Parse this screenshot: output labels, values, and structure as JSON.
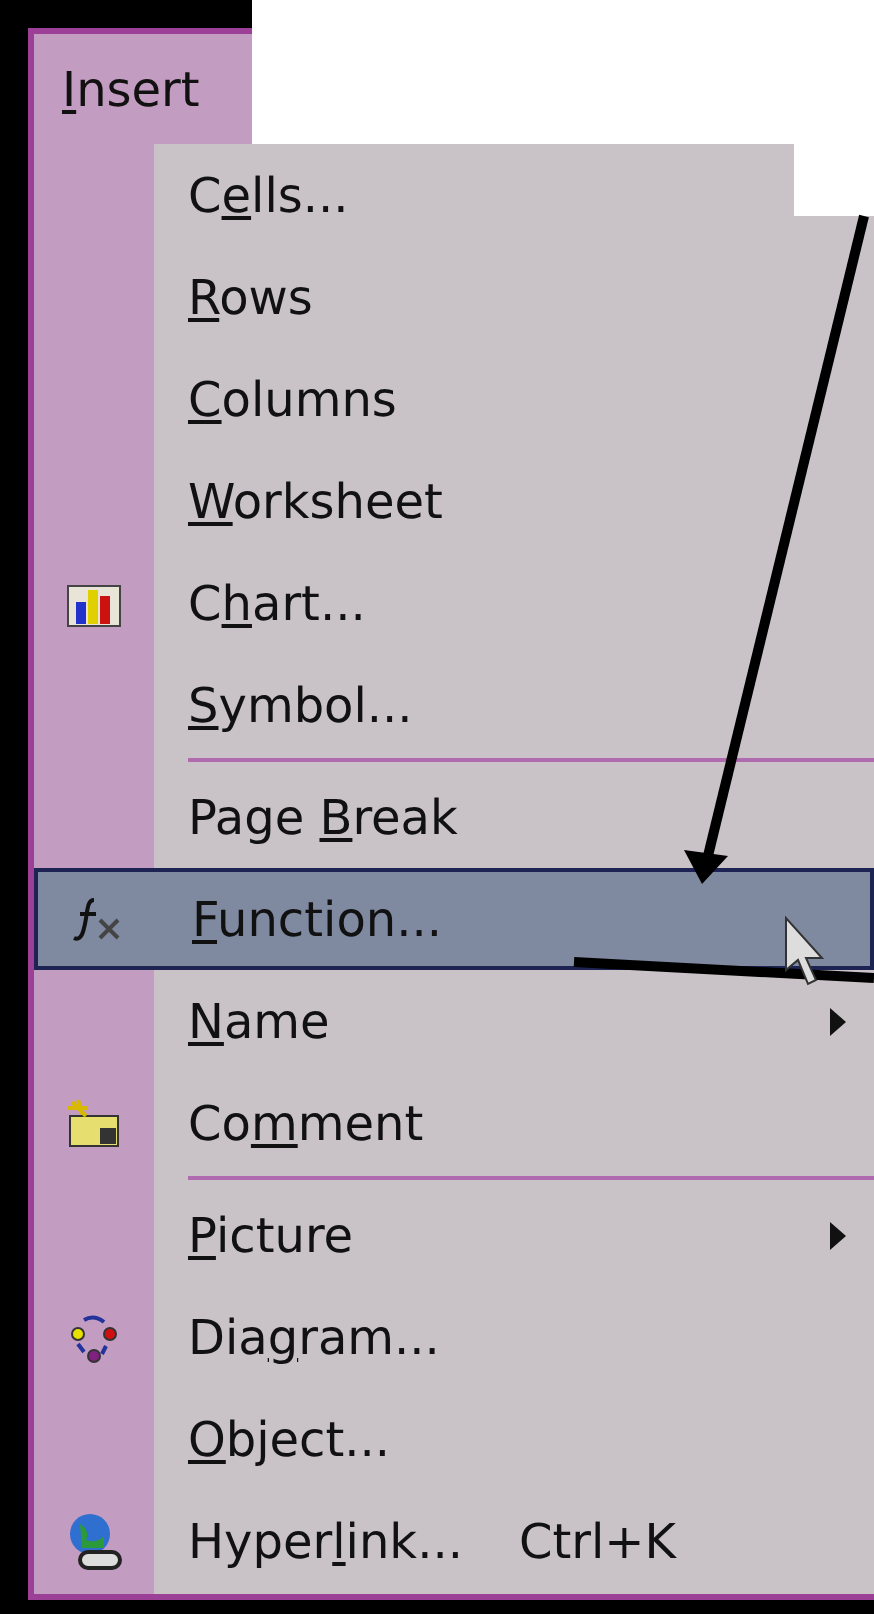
{
  "menu_bar": {
    "title": {
      "key": "I",
      "post": "nsert"
    }
  },
  "items": [
    {
      "kind": "command",
      "label": {
        "pre": "C",
        "key": "e",
        "post": "lls..."
      },
      "selected": false
    },
    {
      "kind": "command",
      "label": {
        "key": "R",
        "post": "ows"
      },
      "selected": false
    },
    {
      "kind": "command",
      "label": {
        "key": "C",
        "post": "olumns"
      },
      "selected": false
    },
    {
      "kind": "command",
      "label": {
        "key": "W",
        "post": "orksheet"
      },
      "selected": false
    },
    {
      "kind": "command",
      "label": {
        "pre": "C",
        "key": "h",
        "post": "art..."
      },
      "selected": false
    },
    {
      "kind": "command",
      "label": {
        "key": "S",
        "post": "ymbol..."
      },
      "selected": false
    },
    {
      "kind": "separator"
    },
    {
      "kind": "command",
      "label": {
        "pre": "Page ",
        "key": "B",
        "post": "reak"
      },
      "selected": false
    },
    {
      "kind": "command",
      "label": {
        "key": "F",
        "post": "unction..."
      },
      "selected": true
    },
    {
      "kind": "submenu",
      "label": {
        "key": "N",
        "post": "ame"
      },
      "selected": false
    },
    {
      "kind": "command",
      "label": {
        "pre": "Co",
        "key": "m",
        "post": "ment"
      },
      "selected": false
    },
    {
      "kind": "separator"
    },
    {
      "kind": "submenu",
      "label": {
        "key": "P",
        "post": "icture"
      },
      "selected": false
    },
    {
      "kind": "command",
      "label": {
        "pre": "Dia",
        "key": "g",
        "post": "ram..."
      },
      "selected": false
    },
    {
      "kind": "command",
      "label": {
        "key": "O",
        "post": "bject..."
      },
      "selected": false
    },
    {
      "kind": "command",
      "label": {
        "pre": "Hyper",
        "key": "l",
        "post": "ink..."
      },
      "shortcut": "Ctrl+K",
      "selected": false
    }
  ]
}
